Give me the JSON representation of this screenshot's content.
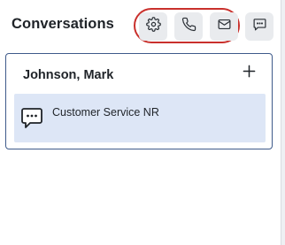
{
  "header": {
    "title": "Conversations",
    "buttons": [
      {
        "name": "settings",
        "icon": "gear-icon"
      },
      {
        "name": "call",
        "icon": "phone-icon"
      },
      {
        "name": "email",
        "icon": "envelope-icon"
      },
      {
        "name": "chat",
        "icon": "chat-icon"
      }
    ],
    "highlight_color": "#c9302c"
  },
  "contact_card": {
    "name": "Johnson, Mark",
    "add_icon": "plus-icon",
    "conversations": [
      {
        "label": "Customer Service NR",
        "icon": "chat-bubble-icon"
      }
    ]
  },
  "colors": {
    "card_border": "#3e5a8a",
    "selected_item_bg": "#dde6f6",
    "button_bg": "#e9ebee"
  }
}
